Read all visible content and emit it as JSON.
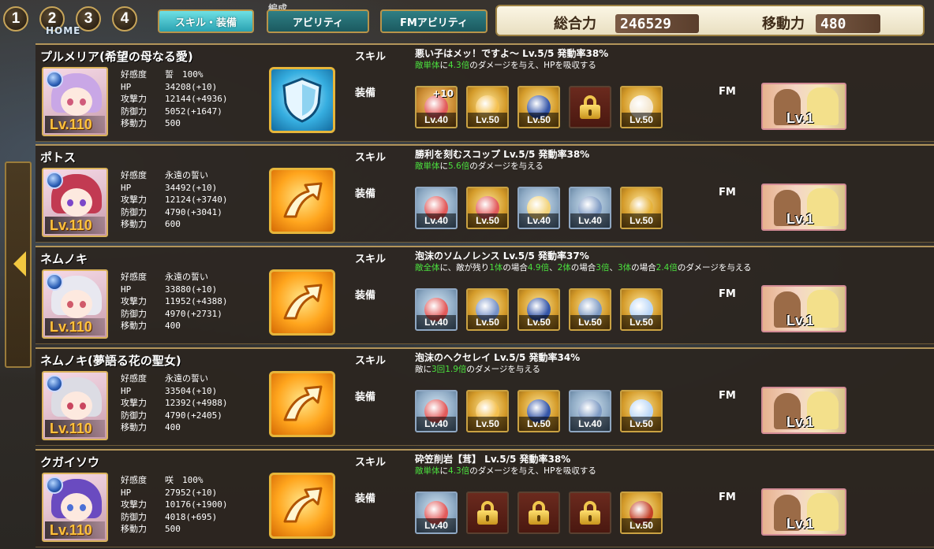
{
  "top_buttons": [
    "1",
    "2",
    "3",
    "4"
  ],
  "home_label": "HOME",
  "header_fragment": "編成",
  "tabs": [
    {
      "label": "スキル・装備",
      "active": true
    },
    {
      "label": "アビリティ",
      "active": false
    },
    {
      "label": "FMアビリティ",
      "active": false
    }
  ],
  "totals": {
    "total_power_label": "総合力",
    "total_power_value": "246529",
    "move_label": "移動力",
    "move_value": "480"
  },
  "labels": {
    "affection": "好感度",
    "hp": "HP",
    "attack": "攻撃力",
    "defense": "防御力",
    "move": "移動力",
    "skill": "スキル",
    "equip": "装備",
    "fm": "FM",
    "fm_level": "Lv.1"
  },
  "characters": [
    {
      "name": "プルメリア(希望の母なる愛)",
      "level": "Lv.110",
      "affection": "誓　100%",
      "hp": "34208(+10)",
      "attack": "12144(+4936)",
      "defense": "5052(+1647)",
      "move": "500",
      "skill_icon": "shield-icon",
      "skill_name": "悪い子はメッ！ですよ～ Lv.5/5 発動率38%",
      "skill_desc": [
        [
          "敵単体",
          "g"
        ],
        [
          "に",
          ""
        ],
        [
          "4.3倍",
          "g"
        ],
        [
          "のダメージを与え、HPを吸収する",
          ""
        ]
      ],
      "equipment": [
        {
          "type": "red",
          "level": "Lv.40",
          "plus": "+10",
          "icon": "ring-icon"
        },
        {
          "type": "gold",
          "level": "Lv.50",
          "icon": "brooch-icon"
        },
        {
          "type": "gold",
          "level": "Lv.50",
          "icon": "necklace-icon"
        },
        {
          "type": "locked",
          "icon": "lock-icon"
        },
        {
          "type": "gold",
          "level": "Lv.50",
          "icon": "scroll-icon"
        }
      ]
    },
    {
      "name": "ポトス",
      "level": "Lv.110",
      "affection": "永遠の誓い",
      "hp": "34492(+10)",
      "attack": "12124(+3740)",
      "defense": "4790(+3041)",
      "move": "600",
      "skill_icon": "arrow-up-icon",
      "skill_name": "勝利を刻むスコップ Lv.5/5 発動率38%",
      "skill_desc": [
        [
          "敵単体",
          "g"
        ],
        [
          "に",
          ""
        ],
        [
          "5.6倍",
          "g"
        ],
        [
          "のダメージを与える",
          ""
        ]
      ],
      "equipment": [
        {
          "type": "silver",
          "level": "Lv.40",
          "icon": "ring-icon"
        },
        {
          "type": "gold",
          "level": "Lv.50",
          "icon": "ring-icon"
        },
        {
          "type": "silver",
          "level": "Lv.40",
          "icon": "crown-icon"
        },
        {
          "type": "silver",
          "level": "Lv.40",
          "icon": "earring-icon"
        },
        {
          "type": "gold",
          "level": "Lv.50",
          "icon": "key-icon"
        }
      ]
    },
    {
      "name": "ネムノキ",
      "level": "Lv.110",
      "affection": "永遠の誓い",
      "hp": "33880(+10)",
      "attack": "11952(+4388)",
      "defense": "4970(+2731)",
      "move": "400",
      "skill_icon": "arrow-up-icon",
      "skill_name": "泡沫のソムノレンス Lv.5/5 発動率37%",
      "skill_desc": [
        [
          "敵全体",
          "g"
        ],
        [
          "に、敵が残り",
          ""
        ],
        [
          "1体",
          "g"
        ],
        [
          "の場合",
          ""
        ],
        [
          "4.9倍",
          "g"
        ],
        [
          "、",
          ""
        ],
        [
          "2体",
          "g"
        ],
        [
          "の場合",
          ""
        ],
        [
          "3倍",
          "g"
        ],
        [
          "、",
          ""
        ],
        [
          "3体",
          "g"
        ],
        [
          "の場合",
          ""
        ],
        [
          "2.4倍",
          "g"
        ],
        [
          "のダメージを与える",
          ""
        ]
      ],
      "equipment": [
        {
          "type": "silver",
          "level": "Lv.40",
          "icon": "ring-icon"
        },
        {
          "type": "gold",
          "level": "Lv.50",
          "icon": "bracelet-icon"
        },
        {
          "type": "gold",
          "level": "Lv.50",
          "icon": "necklace-icon"
        },
        {
          "type": "gold",
          "level": "Lv.50",
          "icon": "earring-icon"
        },
        {
          "type": "gold",
          "level": "Lv.50",
          "icon": "hairpin-icon"
        }
      ]
    },
    {
      "name": "ネムノキ(夢語る花の聖女)",
      "level": "Lv.110",
      "affection": "永遠の誓い",
      "hp": "33504(+10)",
      "attack": "12392(+4988)",
      "defense": "4790(+2405)",
      "move": "400",
      "skill_icon": "arrow-up-icon",
      "skill_name": "泡沫のヘクセレイ Lv.5/5 発動率34%",
      "skill_desc": [
        [
          "敵に",
          ""
        ],
        [
          "3回",
          "g"
        ],
        [
          "1.9倍",
          "g"
        ],
        [
          "のダメージを与える",
          ""
        ]
      ],
      "equipment": [
        {
          "type": "silver",
          "level": "Lv.40",
          "icon": "ring-icon"
        },
        {
          "type": "gold",
          "level": "Lv.50",
          "icon": "brooch-icon"
        },
        {
          "type": "gold",
          "level": "Lv.50",
          "icon": "necklace-icon"
        },
        {
          "type": "silver",
          "level": "Lv.40",
          "icon": "earring-icon"
        },
        {
          "type": "gold",
          "level": "Lv.50",
          "icon": "hairpin-icon"
        }
      ]
    },
    {
      "name": "クガイソウ",
      "level": "Lv.110",
      "affection": "咲　100%",
      "hp": "27952(+10)",
      "attack": "10176(+1900)",
      "defense": "4018(+695)",
      "move": "500",
      "skill_icon": "arrow-up-icon",
      "skill_name": "砕笠削岩【茸】 Lv.5/5 発動率38%",
      "skill_desc": [
        [
          "敵単体",
          "g"
        ],
        [
          "に",
          ""
        ],
        [
          "4.3倍",
          "g"
        ],
        [
          "のダメージを与え、HPを吸収する",
          ""
        ]
      ],
      "equipment": [
        {
          "type": "silver",
          "level": "Lv.40",
          "icon": "ring-icon"
        },
        {
          "type": "locked",
          "icon": "lock-icon"
        },
        {
          "type": "locked",
          "icon": "lock-icon"
        },
        {
          "type": "locked",
          "icon": "lock-icon"
        },
        {
          "type": "gold",
          "level": "Lv.50",
          "icon": "wand-icon"
        }
      ]
    }
  ],
  "colors": {
    "accent_gold": "#caa243",
    "highlight_green": "#4be13e",
    "level_orange": "#ffc23d",
    "tab_teal": "#2aa2b1"
  }
}
